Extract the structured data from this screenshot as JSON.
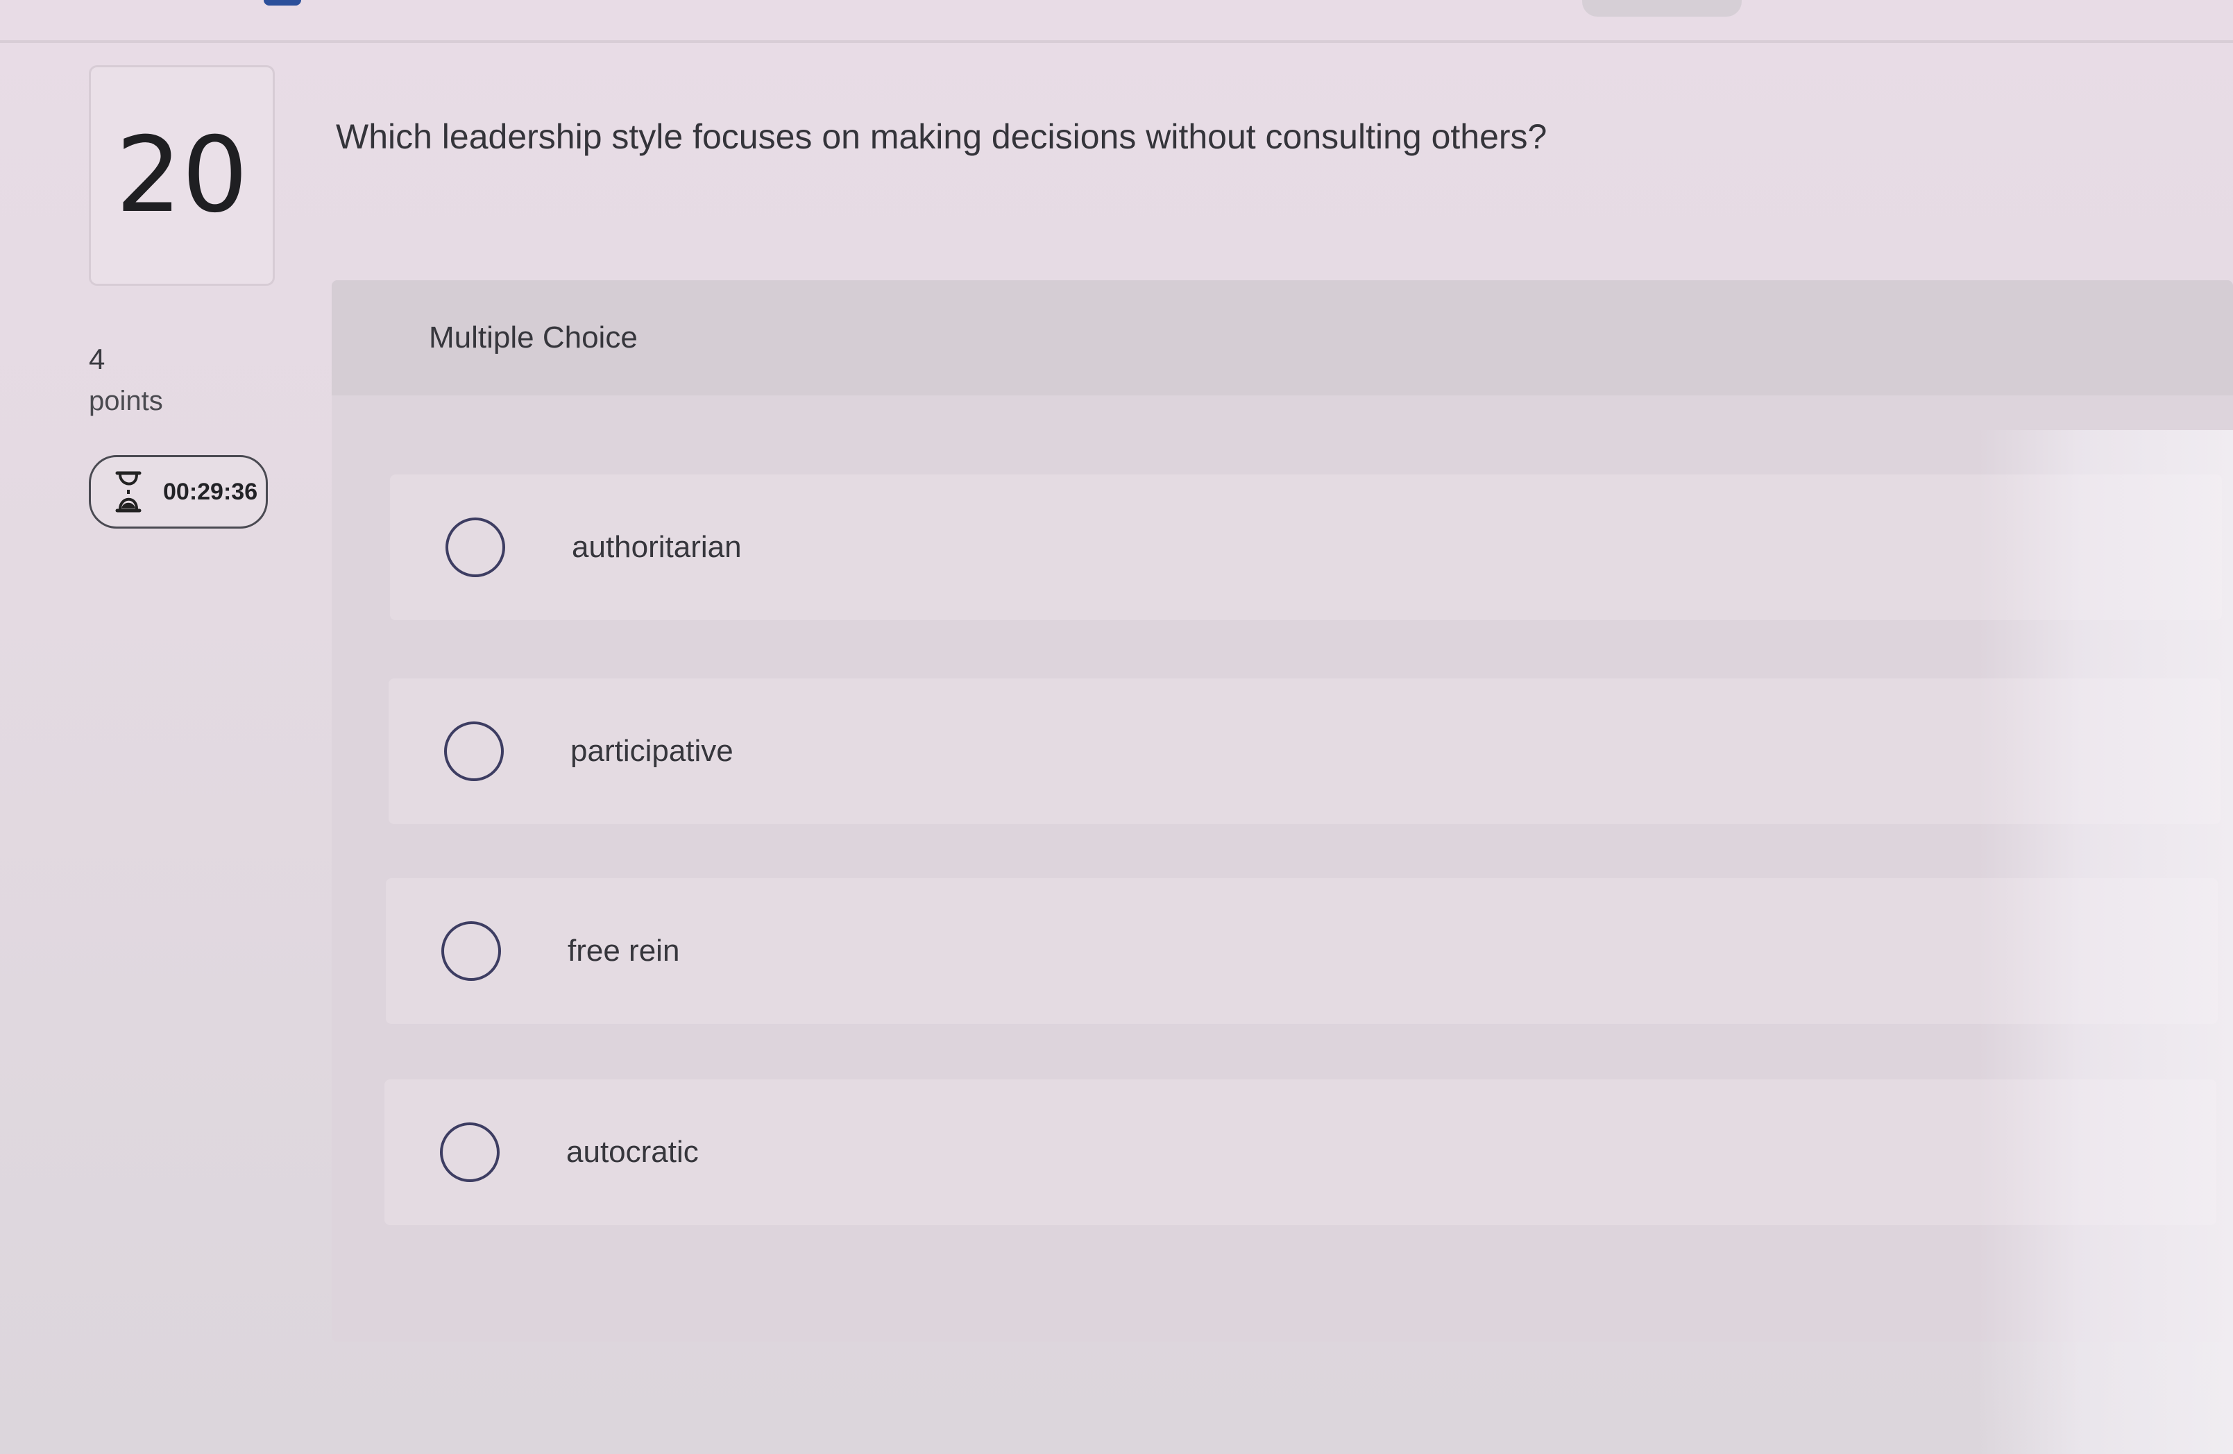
{
  "question": {
    "number": "20",
    "text": "Which leadership style focuses on making decisions without consulting others?",
    "points_value": "4",
    "points_label": "points",
    "timer": "00:29:36",
    "type_label": "Multiple Choice"
  },
  "options": [
    {
      "label": "authoritarian"
    },
    {
      "label": "participative"
    },
    {
      "label": "free rein"
    },
    {
      "label": "autocratic"
    }
  ],
  "icons": {
    "timer": "hourglass-icon",
    "choice": "radio-circle-icon"
  },
  "colors": {
    "radio_border": "#3d3d62",
    "timer_border": "#4a4a52",
    "accent": "#2b4f9a"
  }
}
